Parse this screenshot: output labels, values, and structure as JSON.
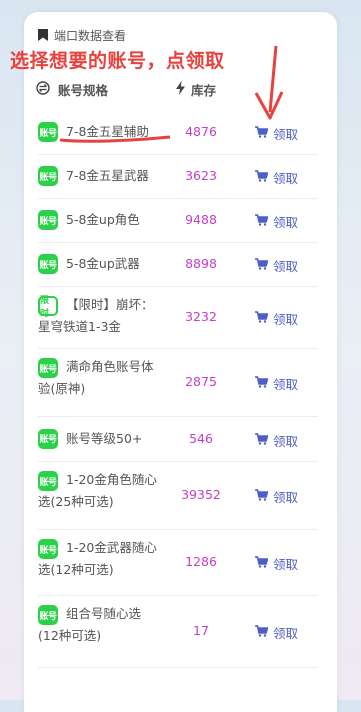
{
  "card_title": "端口数据查看",
  "hint": "选择想要的账号，点领取",
  "header": {
    "spec": "账号规格",
    "stock": "库存"
  },
  "tag_labels": {
    "normal": "账号",
    "limited": "限时"
  },
  "claim_label": "领取",
  "rows": [
    {
      "name": "7-8金五星辅助",
      "stock": "4876",
      "tag": "normal"
    },
    {
      "name": "7-8金五星武器",
      "stock": "3623",
      "tag": "normal"
    },
    {
      "name": "5-8金up角色",
      "stock": "9488",
      "tag": "normal"
    },
    {
      "name": "5-8金up武器",
      "stock": "8898",
      "tag": "normal"
    },
    {
      "name_line1": "【限时】崩坏：",
      "name_line2": "星穹铁道1-3金",
      "stock": "3232",
      "tag": "limited"
    },
    {
      "name_line1": "满命角色账号体",
      "name_line2": "验(原神)",
      "stock": "2875",
      "tag": "normal"
    },
    {
      "name": "账号等级50+",
      "stock": "546",
      "tag": "normal"
    },
    {
      "name_line1": "1-20金角色随心",
      "name_line2": "选(25种可选)",
      "stock": "39352",
      "tag": "normal"
    },
    {
      "name_line1": "1-20金武器随心",
      "name_line2": "选(12种可选)",
      "stock": "1286",
      "tag": "normal"
    },
    {
      "name_line1": "组合号随心选",
      "name_line2": "(12种可选)",
      "stock": "17",
      "tag": "normal"
    }
  ],
  "colors": {
    "accent_red": "#e8413e",
    "stock_purple": "#c43fc9",
    "claim_blue": "#4e5ec8",
    "tag_green": "#2bd148"
  }
}
